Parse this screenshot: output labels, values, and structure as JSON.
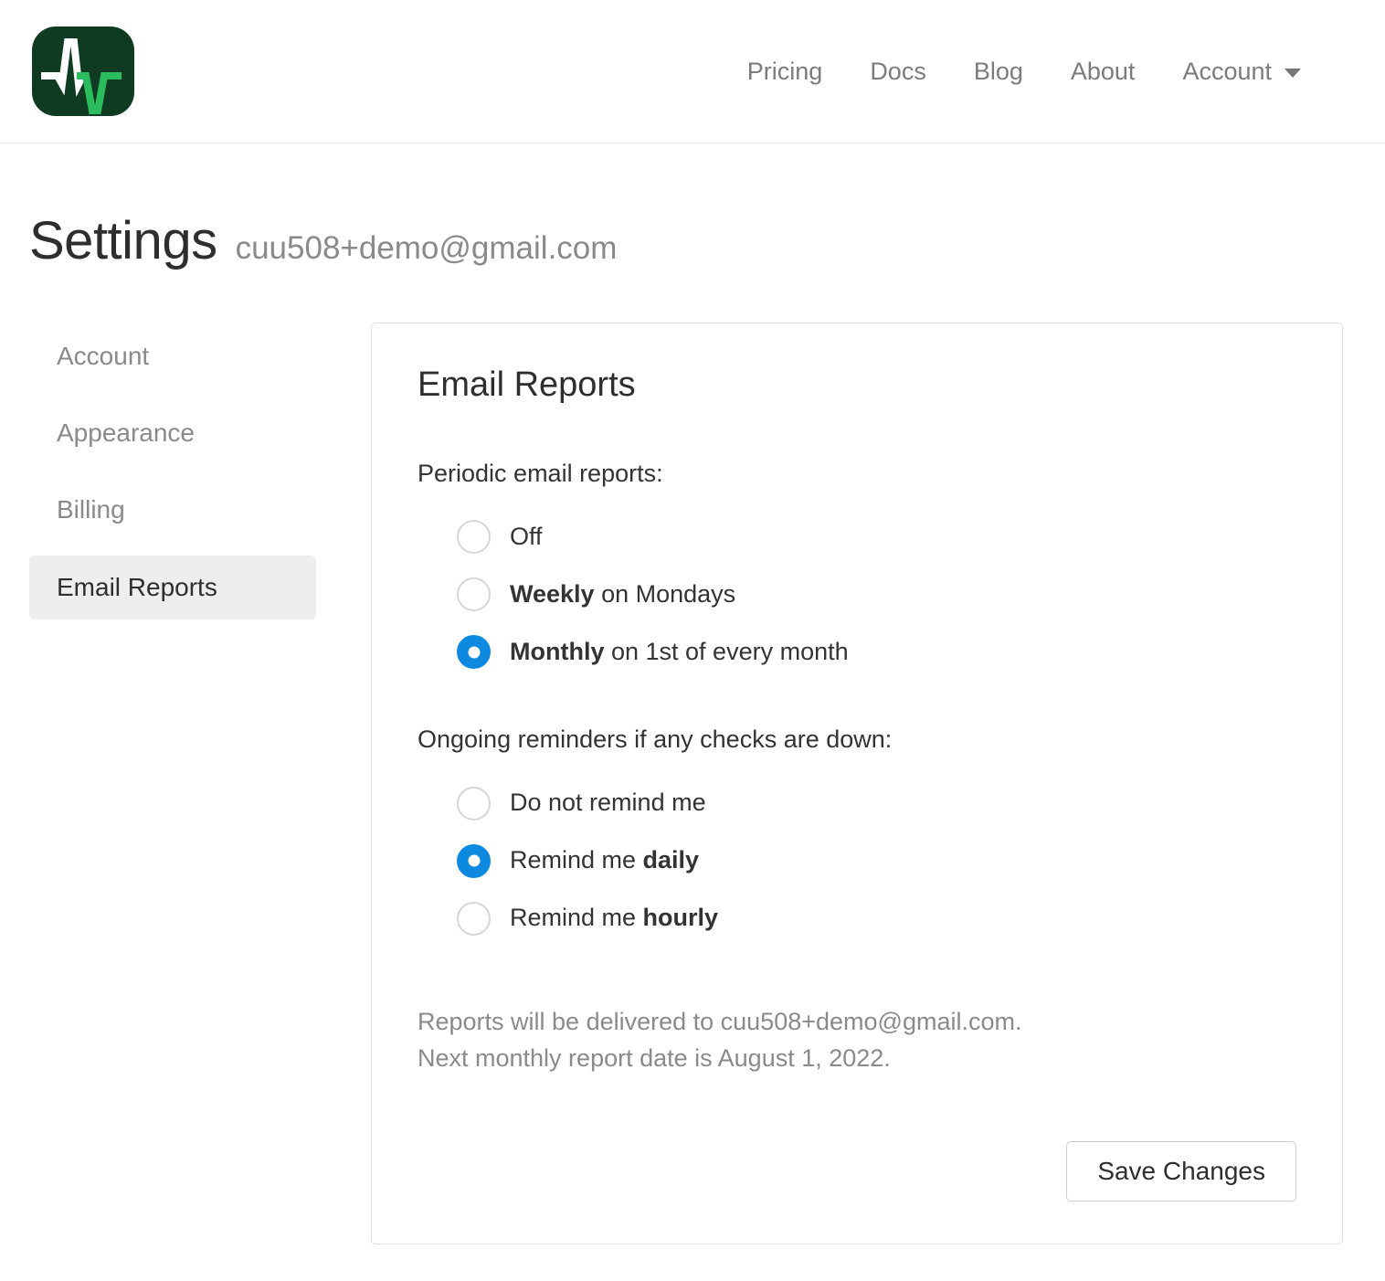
{
  "header": {
    "logo_icon": "pulse-logo-icon",
    "logo_bg_color": "#0e3b22",
    "logo_white_color": "#ffffff",
    "logo_green_color": "#2bbc5d",
    "nav": [
      {
        "label": "Pricing",
        "name": "nav-link-pricing"
      },
      {
        "label": "Docs",
        "name": "nav-link-docs"
      },
      {
        "label": "Blog",
        "name": "nav-link-blog"
      },
      {
        "label": "About",
        "name": "nav-link-about"
      }
    ],
    "account_label": "Account",
    "account_caret_icon": "chevron-down-icon"
  },
  "page": {
    "title": "Settings",
    "subtitle": "cuu508+demo@gmail.com"
  },
  "sidebar": {
    "items": [
      {
        "label": "Account",
        "name": "sidebar-item-account",
        "active": false
      },
      {
        "label": "Appearance",
        "name": "sidebar-item-appearance",
        "active": false
      },
      {
        "label": "Billing",
        "name": "sidebar-item-billing",
        "active": false
      },
      {
        "label": "Email Reports",
        "name": "sidebar-item-email-reports",
        "active": true
      }
    ],
    "active_bg_color": "#eeeeee"
  },
  "card": {
    "title": "Email Reports",
    "periodic": {
      "label": "Periodic email reports:",
      "options": [
        {
          "prefix": "",
          "strong": "",
          "suffix": "Off",
          "text": "Off",
          "checked": false
        },
        {
          "prefix": "",
          "strong": "Weekly",
          "suffix": " on Mondays",
          "text": "Weekly on Mondays",
          "checked": false
        },
        {
          "prefix": "",
          "strong": "Monthly",
          "suffix": " on 1st of every month",
          "text": "Monthly on 1st of every month",
          "checked": true
        }
      ],
      "selected": "Monthly on 1st of every month"
    },
    "reminders": {
      "label": "Ongoing reminders if any checks are down:",
      "options": [
        {
          "prefix": "Do not remind me",
          "strong": "",
          "suffix": "",
          "text": "Do not remind me",
          "checked": false
        },
        {
          "prefix": "Remind me ",
          "strong": "daily",
          "suffix": "",
          "text": "Remind me daily",
          "checked": true
        },
        {
          "prefix": "Remind me ",
          "strong": "hourly",
          "suffix": "",
          "text": "Remind me hourly",
          "checked": false
        }
      ],
      "selected": "Remind me daily"
    },
    "note_line_1": "Reports will be delivered to cuu508+demo@gmail.com.",
    "note_line_2": "Next monthly report date is August 1, 2022.",
    "save_label": "Save Changes",
    "radio_accent_color": "#0d8ae0",
    "border_color": "#e2e2e2"
  }
}
